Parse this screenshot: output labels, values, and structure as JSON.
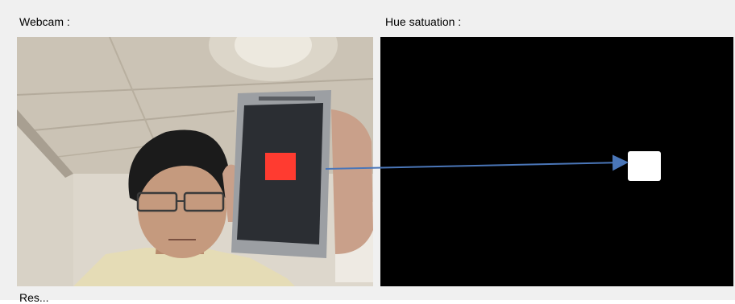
{
  "labels": {
    "webcam": "Webcam :",
    "hue": "Hue satuation :",
    "result": "Res..."
  },
  "colors": {
    "window_bg": "#f0f0f0",
    "hue_bg": "#000000",
    "detected_red": "#ff3b30",
    "detected_white": "#ffffff",
    "arrow": "#4a76b8"
  },
  "icons": {
    "arrow": "arrow-right-icon"
  }
}
